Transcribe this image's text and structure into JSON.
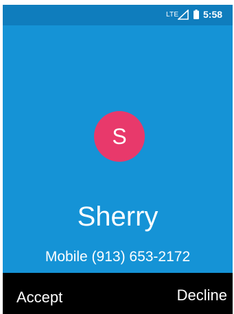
{
  "status_bar": {
    "network": "LTE",
    "signal_icon": "signal-icon",
    "battery_icon": "battery-icon",
    "time": "5:58"
  },
  "caller": {
    "avatar_initial": "S",
    "avatar_color": "#e8396b",
    "name": "Sherry",
    "number_line": "Mobile (913) 653-2172"
  },
  "softkeys": {
    "accept_label": "Accept",
    "decline_label": "Decline"
  },
  "colors": {
    "background": "#1593d6",
    "status_bar": "#0f7dbd",
    "softkey_bar": "#000000"
  }
}
